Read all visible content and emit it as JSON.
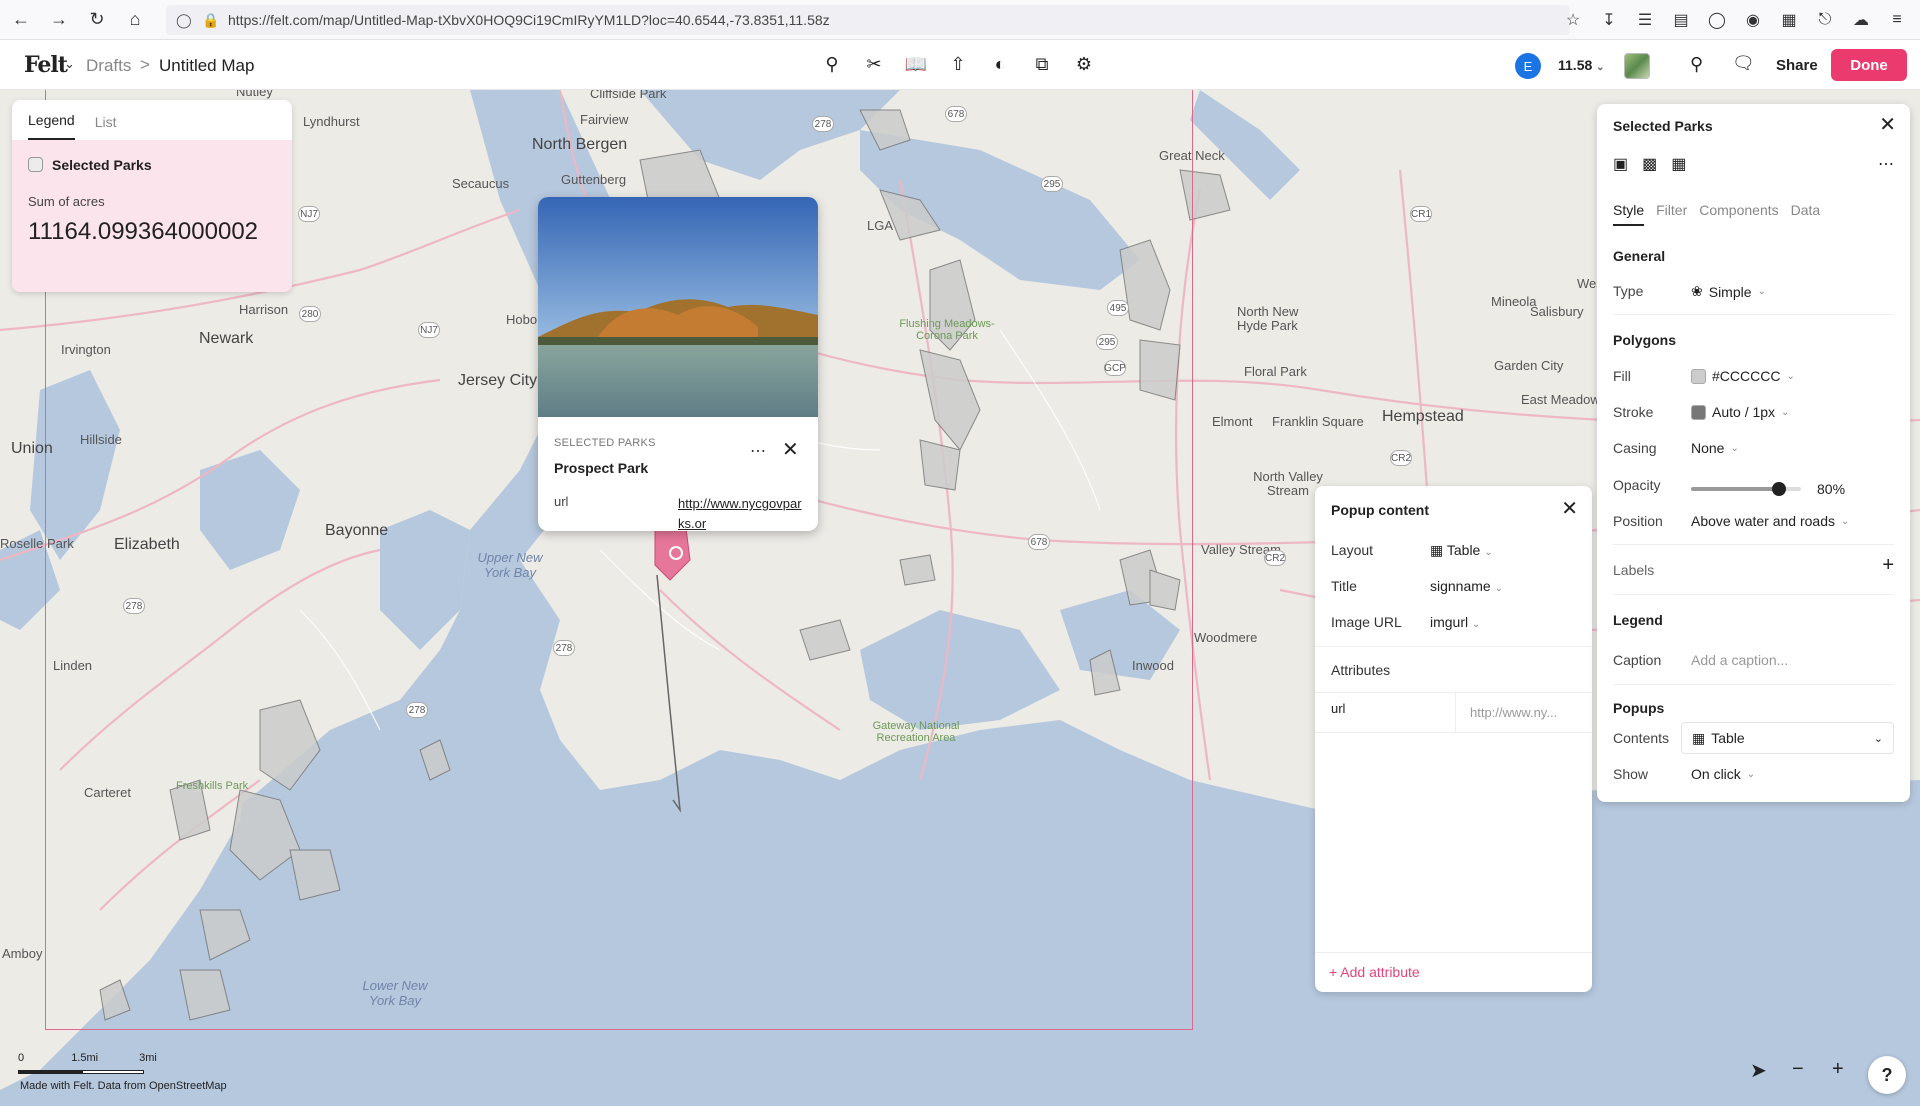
{
  "browser": {
    "url": "https://felt.com/map/Untitled-Map-tXbvX0HOQ9Ci19CmIRyYM1LD?loc=40.6544,-73.8351,11.58z"
  },
  "header": {
    "logo": "Felt",
    "breadcrumb_parent": "Drafts",
    "breadcrumb_sep": ">",
    "map_title": "Untitled Map",
    "user_initial": "E",
    "zoom": "11.58",
    "share_label": "Share",
    "done_label": "Done"
  },
  "legend": {
    "tabs": [
      "Legend",
      "List"
    ],
    "layer_name": "Selected Parks",
    "sum_label": "Sum of acres",
    "sum_value": "11164.099364000002"
  },
  "feature_popup": {
    "category": "SELECTED PARKS",
    "title": "Prospect Park",
    "attr_key": "url",
    "attr_value": "http://www.nycgovparks.or"
  },
  "popup_editor": {
    "title": "Popup content",
    "layout_label": "Layout",
    "layout_value": "Table",
    "title_label": "Title",
    "title_value": "signname",
    "image_label": "Image URL",
    "image_value": "imgurl",
    "attributes_label": "Attributes",
    "attr_key": "url",
    "attr_placeholder": "http://www.ny...",
    "add_attribute": "+ Add attribute"
  },
  "style_panel": {
    "title": "Selected Parks",
    "tabs": [
      "Style",
      "Filter",
      "Components",
      "Data"
    ],
    "general": "General",
    "type_label": "Type",
    "type_value": "Simple",
    "polygons": "Polygons",
    "fill_label": "Fill",
    "fill_value": "#CCCCCC",
    "stroke_label": "Stroke",
    "stroke_value": "Auto / 1px",
    "casing_label": "Casing",
    "casing_value": "None",
    "opacity_label": "Opacity",
    "opacity_value": "80%",
    "opacity": 0.8,
    "position_label": "Position",
    "position_value": "Above water and roads",
    "labels_label": "Labels",
    "legend": "Legend",
    "caption_label": "Caption",
    "caption_placeholder": "Add a caption...",
    "popups": "Popups",
    "contents_label": "Contents",
    "contents_value": "Table",
    "show_label": "Show",
    "show_value": "On click"
  },
  "map": {
    "places": [
      "Nutley",
      "Lyndhurst",
      "Cliffside Park",
      "Fairview",
      "North Bergen",
      "Secaucus",
      "Guttenberg",
      "Great Neck",
      "Newark",
      "Harrison",
      "Irvington",
      "Jersey City",
      "Hoboken",
      "Union",
      "Hillside",
      "Elizabeth",
      "Bayonne",
      "Linden",
      "Carteret",
      "Roselle Park",
      "Mineola",
      "Westbury",
      "Salisbury",
      "North New Hyde Park",
      "Floral Park",
      "Garden City",
      "East Meadow",
      "Hempstead",
      "Elmont",
      "Franklin Square",
      "North Valley Stream",
      "Valley Stream",
      "Woodmere",
      "Inwood",
      "LGA",
      "Amboy"
    ],
    "water": [
      "Upper New York Bay",
      "Lower New York Bay"
    ],
    "parks": [
      "Flushing Meadows-Corona Park",
      "Gateway National Recreation Area",
      "Freshkills Park"
    ],
    "scale": [
      "0",
      "1.5mi",
      "3mi"
    ],
    "attribution": "Made with Felt. Data from OpenStreetMap"
  },
  "colors": {
    "accent": "#ea3a6e",
    "fill": "#CCCCCC",
    "water": "#b6c8de",
    "land": "#ecebe6"
  }
}
